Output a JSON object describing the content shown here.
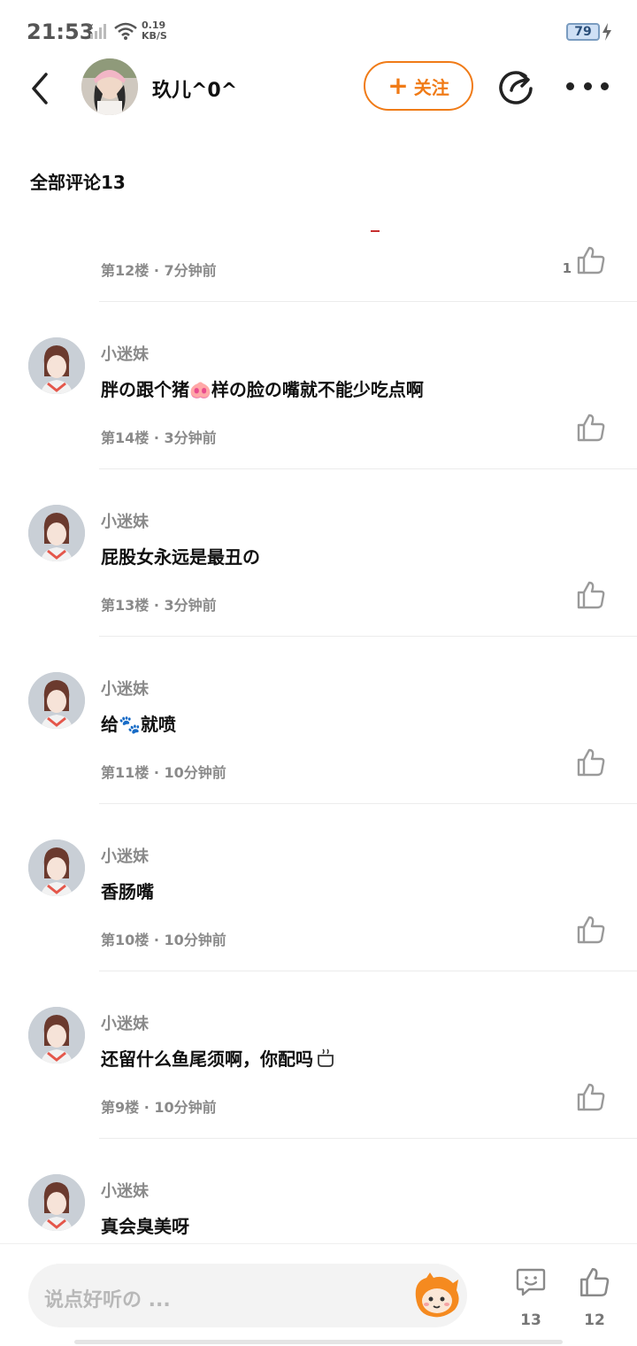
{
  "status_bar": {
    "time": "21:53",
    "speed_value": "0.19",
    "speed_unit": "KB/S",
    "battery": "79"
  },
  "header": {
    "user_name": "玖儿^0^",
    "follow_label": "关注"
  },
  "section_title": "全部评论13",
  "comments": [
    {
      "author": "",
      "text": "",
      "floor": "第12楼",
      "time": "7分钟前",
      "likes": "1"
    },
    {
      "author": "小迷妹",
      "text": "胖の跟个猪🐽样の脸の嘴就不能少吃点啊",
      "floor": "第14楼",
      "time": "3分钟前",
      "likes": ""
    },
    {
      "author": "小迷妹",
      "text": "屁股女永远是最丑の",
      "floor": "第13楼",
      "time": "3分钟前",
      "likes": ""
    },
    {
      "author": "小迷妹",
      "text": "给🐾就喷",
      "floor": "第11楼",
      "time": "10分钟前",
      "likes": ""
    },
    {
      "author": "小迷妹",
      "text": "香肠嘴",
      "floor": "第10楼",
      "time": "10分钟前",
      "likes": ""
    },
    {
      "author": "小迷妹",
      "text": "还留什么鱼尾须啊，你配吗",
      "floor": "第9楼",
      "time": "10分钟前",
      "likes": ""
    },
    {
      "author": "小迷妹",
      "text": "真会臭美呀",
      "floor": "",
      "time": "",
      "likes": ""
    }
  ],
  "bottom_bar": {
    "input_placeholder": "说点好听の ...",
    "comment_count": "13",
    "like_count": "12"
  },
  "colors": {
    "accent": "#f07b17",
    "muted_text": "#8a8a8a",
    "divider": "#ececec"
  },
  "icons": [
    "back-arrow-icon",
    "share-icon",
    "more-icon",
    "thumbs-up-icon",
    "comment-bubble-icon",
    "mascot-icon"
  ]
}
